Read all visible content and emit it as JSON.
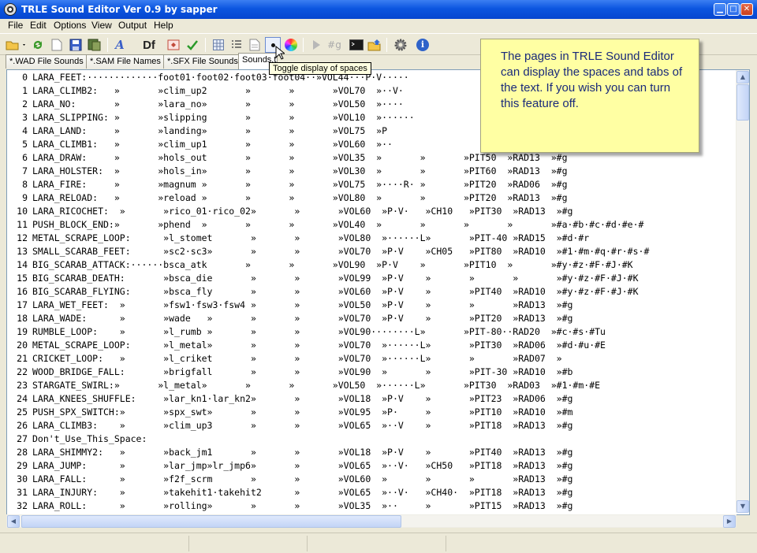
{
  "window": {
    "title": "TRLE Sound Editor Ver 0.9 by sapper",
    "title_color": "#0a50d8"
  },
  "menu": [
    "File",
    "Edit",
    "Options",
    "View",
    "Output",
    "Help"
  ],
  "toolbar": {
    "icons": [
      "open-icon",
      "refresh-icon",
      "new-icon",
      "save-icon",
      "save-as-icon",
      "italic-a-icon",
      "df-icon",
      "exe-icon",
      "checkmark-icon",
      "grid-icon",
      "list-icon",
      "page-icon",
      "toggle-spaces-icon",
      "color-wheel-icon",
      "play-icon",
      "hash-icon",
      "console-icon",
      "export-icon",
      "settings-icon",
      "info-icon"
    ],
    "df_label": "Df",
    "hash_label": "#g"
  },
  "tabs": [
    "*.WAD File Sounds",
    "*.SAM File Names",
    "*.SFX File Sounds",
    "Sounds.t"
  ],
  "tooltip": "Toggle display of spaces",
  "note": "The pages in TRLE Sound Editor can display the spaces and tabs of the text. If you wish you can turn this feature off.",
  "editor": {
    "lines": [
      {
        "n": "0",
        "t": "LARA_FEET:·············foot01·foot02·foot03·foot04··»VOL44···P·V·····"
      },
      {
        "n": "1",
        "t": "LARA_CLIMB2:   »       »clim_up2       »       »       »VOL70  »··V·"
      },
      {
        "n": "2",
        "t": "LARA_NO:       »       »lara_no»       »       »       »VOL50  »····"
      },
      {
        "n": "3",
        "t": "LARA_SLIPPING: »       »slipping       »       »       »VOL10  »······"
      },
      {
        "n": "4",
        "t": "LARA_LAND:     »       »landing»       »       »       »VOL75  »P"
      },
      {
        "n": "5",
        "t": "LARA_CLIMB1:   »       »clim_up1       »       »       »VOL60  »··"
      },
      {
        "n": "6",
        "t": "LARA_DRAW:     »       »hols_out       »       »       »VOL35  »       »       »PIT50  »RAD13  »#g"
      },
      {
        "n": "7",
        "t": "LARA_HOLSTER:  »       »hols_in»       »       »       »VOL30  »       »       »PIT60  »RAD13  »#g"
      },
      {
        "n": "8",
        "t": "LARA_FIRE:     »       »magnum »       »       »       »VOL75  »····R· »       »PIT20  »RAD06  »#g"
      },
      {
        "n": "9",
        "t": "LARA_RELOAD:   »       »reload »       »       »       »VOL80  »       »       »PIT20  »RAD13  »#g"
      },
      {
        "n": "10",
        "t": "LARA_RICOCHET:  »       »rico_01·rico_02»       »       »VOL60  »P·V·   »CH10   »PIT30  »RAD13  »#g"
      },
      {
        "n": "11",
        "t": "PUSH_BLOCK_END:»       »phend  »       »       »       »VOL40  »       »       »       »       »#a·#b·#c·#d·#e·#"
      },
      {
        "n": "12",
        "t": "METAL_SCRAPE_LOOP:      »l_stomet       »       »       »VOL80  »······L»       »PIT-40 »RAD15  »#d·#r"
      },
      {
        "n": "13",
        "t": "SMALL_SCARAB_FEET:      »sc2·sc3»       »       »       »VOL70  »P·V    »CH05   »PIT80  »RAD10  »#1·#m·#q·#r·#s·#"
      },
      {
        "n": "14",
        "t": "BIG_SCARAB_ATTACK:······bsca_atk       »       »       »VOL90  »P·V    »       »PIT10  »       »#y·#z·#F·#J·#K"
      },
      {
        "n": "15",
        "t": "BIG_SCARAB_DEATH:       »bsca_die       »       »       »VOL99  »P·V    »       »       »       »#y·#z·#F·#J·#K"
      },
      {
        "n": "16",
        "t": "BIG_SCARAB_FLYING:      »bsca_fly       »       »       »VOL60  »P·V    »       »PIT40  »RAD10  »#y·#z·#F·#J·#K"
      },
      {
        "n": "17",
        "t": "LARA_WET_FEET:  »       »fsw1·fsw3·fsw4 »       »       »VOL50  »P·V    »       »       »RAD13  »#g"
      },
      {
        "n": "18",
        "t": "LARA_WADE:      »       »wade   »       »       »       »VOL70  »P·V    »       »PIT20  »RAD13  »#g"
      },
      {
        "n": "19",
        "t": "RUMBLE_LOOP:    »       »l_rumb »       »       »       »VOL90········L»       »PIT-80··RAD20  »#c·#s·#Tu"
      },
      {
        "n": "20",
        "t": "METAL_SCRAPE_LOOP:      »l_metal»       »       »       »VOL70  »······L»       »PIT30  »RAD06  »#d·#u·#E"
      },
      {
        "n": "21",
        "t": "CRICKET_LOOP:   »       »l_criket       »       »       »VOL70  »······L»       »       »RAD07  »"
      },
      {
        "n": "22",
        "t": "WOOD_BRIDGE_FALL:       »brigfall       »       »       »VOL90  »       »       »PIT-30 »RAD10  »#b"
      },
      {
        "n": "23",
        "t": "STARGATE_SWIRL:»       »l_metal»       »       »       »VOL50  »······L»       »PIT30  »RAD03  »#1·#m·#E"
      },
      {
        "n": "24",
        "t": "LARA_KNEES_SHUFFLE:     »lar_kn1·lar_kn2»       »       »VOL18  »P·V    »       »PIT23  »RAD06  »#g"
      },
      {
        "n": "25",
        "t": "PUSH_SPX_SWITCH:»       »spx_swt»       »       »       »VOL95  »P·     »       »PIT10  »RAD10  »#m"
      },
      {
        "n": "26",
        "t": "LARA_CLIMB3:    »       »clim_up3       »       »       »VOL65  »··V    »       »PIT18  »RAD13  »#g"
      },
      {
        "n": "27",
        "t": "Don't_Use_This_Space:"
      },
      {
        "n": "28",
        "t": "LARA_SHIMMY2:   »       »back_jm1       »       »       »VOL18  »P·V    »       »PIT40  »RAD13  »#g"
      },
      {
        "n": "29",
        "t": "LARA_JUMP:      »       »lar_jmp»lr_jmp6»       »       »VOL65  »··V·   »CH50   »PIT18  »RAD13  »#g"
      },
      {
        "n": "30",
        "t": "LARA_FALL:      »       »f2f_scrm       »       »       »VOL60  »       »       »       »RAD13  »#g"
      },
      {
        "n": "31",
        "t": "LARA_INJURY:    »       »takehit1·takehit2      »       »VOL65  »··V·   »CH40·  »PIT18  »RAD13  »#g"
      },
      {
        "n": "32",
        "t": "LARA_ROLL:      »       »rolling»       »       »       »VOL35  »··     »       »PIT15  »RAD13  »#g"
      }
    ]
  },
  "colors": {
    "chrome": "#ece9d8",
    "note_bg": "#ffffa3",
    "note_text": "#1a2a7a"
  }
}
